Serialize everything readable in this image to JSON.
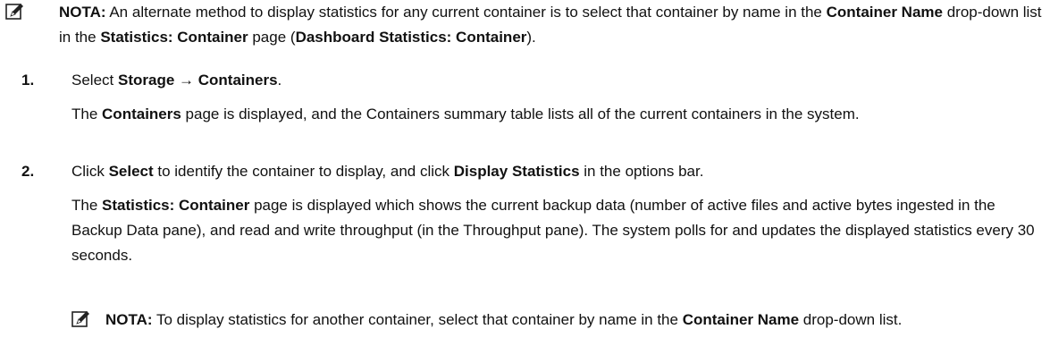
{
  "note_top": {
    "icon": "note-pencil-icon",
    "label": "NOTA:",
    "t1": " An alternate method to display statistics for any current container is to select that container by name in the ",
    "b1": "Container Name",
    "t2": " drop-down list in the ",
    "b2": "Statistics: Container",
    "t3": " page (",
    "b3": "Dashboard Statistics: Container",
    "t4": ")."
  },
  "steps": [
    {
      "number": "1.",
      "action": {
        "t1": "Select ",
        "b1": "Storage",
        "arrow": " → ",
        "b2": "Containers",
        "t2": "."
      },
      "desc": {
        "t1": "The ",
        "b1": "Containers",
        "t2": " page is displayed, and the Containers summary table lists all of the current containers in the system."
      }
    },
    {
      "number": "2.",
      "action": {
        "t1": "Click ",
        "b1": "Select",
        "t2": " to identify the container to display, and click ",
        "b2": "Display Statistics",
        "t3": " in the options bar."
      },
      "desc": {
        "t1": "The ",
        "b1": "Statistics: Container",
        "t2": " page is displayed which shows the current backup data (number of active files and active bytes ingested in the Backup Data pane), and read and write throughput (in the Throughput pane). The system polls for and updates the displayed statistics every 30 seconds."
      }
    }
  ],
  "note_bottom": {
    "icon": "note-pencil-icon",
    "label": "NOTA:",
    "t1": " To display statistics for another container, select that container by name in the ",
    "b1": "Container Name",
    "t2": " drop-down list."
  }
}
